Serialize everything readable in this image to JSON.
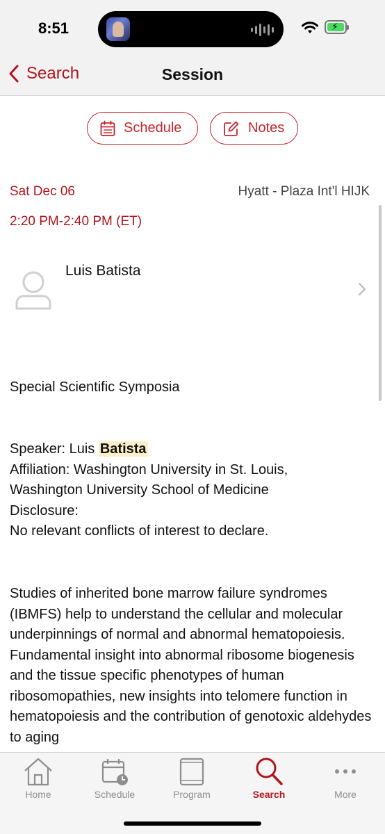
{
  "status_bar": {
    "time": "8:51"
  },
  "nav": {
    "back_label": "Search",
    "title": "Session"
  },
  "actions": {
    "schedule_label": "Schedule",
    "notes_label": "Notes"
  },
  "session": {
    "date": "Sat Dec 06",
    "time_range": "2:20 PM-2:40 PM (ET)",
    "location": "Hyatt - Plaza Int'l HIJK",
    "speaker_name": "Luis Batista",
    "track": "Special Scientific Symposia"
  },
  "details": {
    "speaker_prefix": "Speaker: Luis ",
    "speaker_highlight": "Batista",
    "affiliation_line1": "Affiliation: Washington University in St. Louis,",
    "affiliation_line2": "Washington University School of Medicine",
    "disclosure_label": "Disclosure:",
    "disclosure_value": "No relevant conflicts of interest to declare."
  },
  "abstract": "Studies of inherited bone marrow failure syndromes (IBMFS) help to understand the cellular and molecular underpinnings of normal and abnormal hematopoiesis. Fundamental insight into abnormal ribosome biogenesis and the tissue specific phenotypes of human ribosomopathies,  new insights into telomere function in hematopoiesis and the contribution of genotoxic aldehydes to aging",
  "tabs": [
    {
      "label": "Home",
      "icon": "home-icon",
      "active": false
    },
    {
      "label": "Schedule",
      "icon": "calendar-clock-icon",
      "active": false
    },
    {
      "label": "Program",
      "icon": "book-icon",
      "active": false
    },
    {
      "label": "Search",
      "icon": "search-icon",
      "active": true
    },
    {
      "label": "More",
      "icon": "more-icon",
      "active": false
    }
  ],
  "colors": {
    "accent": "#b0151c",
    "button_border": "#c8242b",
    "highlight": "#fbefc8",
    "inactive_tab": "#8e8e8e"
  }
}
